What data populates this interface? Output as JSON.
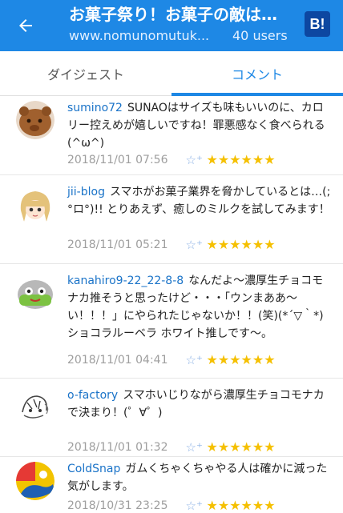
{
  "header": {
    "back_icon": "arrow-left-icon",
    "title": "お菓子祭り！お菓子の敵は…",
    "url": "www.nomunomutuk...",
    "users": "40 users",
    "hatena_badge": "B!"
  },
  "tabs": [
    {
      "label": "ダイジェスト",
      "active": false
    },
    {
      "label": "コメント",
      "active": true
    }
  ],
  "comments": [
    {
      "user": "sumino72",
      "text": "SUNAOはサイズも味もいいのに、カロリー控えめが嬉しいですね！罪悪感なく食べられる(^ω^)",
      "timestamp": "2018/11/01 07:56",
      "stars": "★★★★★★",
      "avatar_icon": "brown-bear-avatar"
    },
    {
      "user": "jii-blog",
      "text": "スマホがお菓子業界を脅かしているとは…(;°ロ°)!! とりあえず、癒しのミルクを試してみます！",
      "timestamp": "2018/11/01 05:21",
      "stars": "★★★★★★",
      "avatar_icon": "anime-girl-avatar"
    },
    {
      "user": "kanahiro9-22_22-8-8",
      "text": "なんだよ〜濃厚生チョコモナカ推そうと思ったけど・・・「ウンまああ〜い！！！」にやられたじゃないか！！(笑)(*´▽｀*)ショコラルーベラ ホワイト推しです〜。",
      "timestamp": "2018/11/01 04:41",
      "stars": "★★★★★★",
      "avatar_icon": "robot-avatar"
    },
    {
      "user": "o-factory",
      "text": "スマホいじりながら濃厚生チョコモナカで決まり！(゜∀゜)",
      "timestamp": "2018/11/01 01:32",
      "stars": "★★★★★★",
      "avatar_icon": "sketch-avatar"
    },
    {
      "user": "ColdSnap",
      "text": "ガムくちゃくちゃやる人は確かに減った気がします。",
      "timestamp": "2018/10/31 23:25",
      "stars": "★★★★★★",
      "avatar_icon": "colorful-avatar"
    }
  ],
  "colors": {
    "header_bg": "#1e88e5",
    "accent": "#1e88e5",
    "username": "#1a73c8",
    "star": "#f5c000"
  }
}
